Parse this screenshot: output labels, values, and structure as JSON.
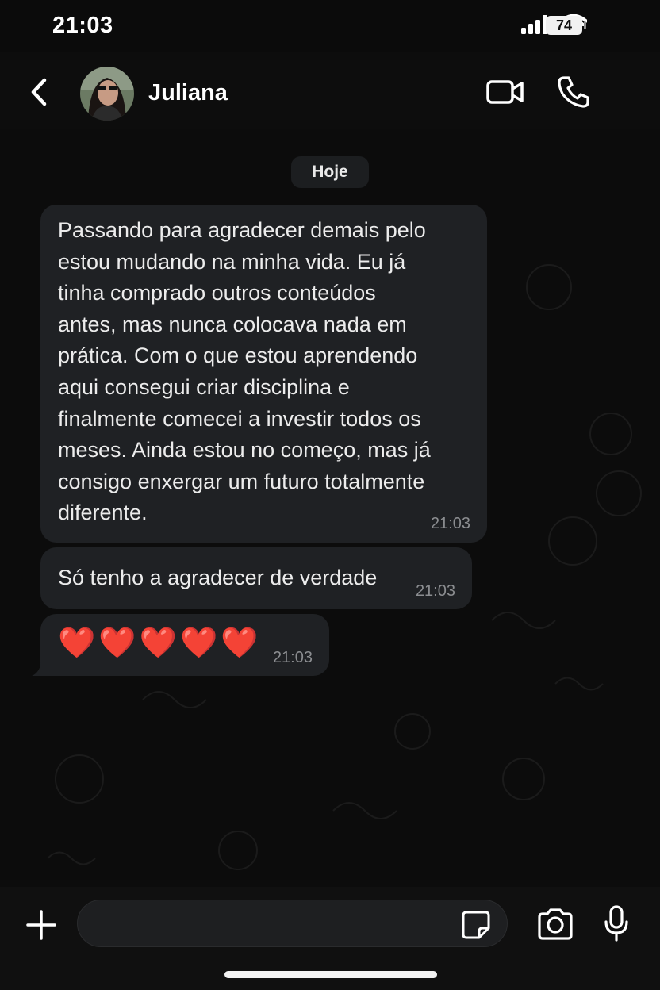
{
  "status_bar": {
    "time": "21:03",
    "battery": "74",
    "icons": [
      "signal-icon",
      "wifi-icon",
      "battery-icon"
    ]
  },
  "header": {
    "contact_name": "Juliana",
    "icons": {
      "back": "chevron-left-icon",
      "video": "video-camera-icon",
      "call": "phone-icon"
    }
  },
  "chat": {
    "date_label": "Hoje",
    "messages": [
      {
        "lines": [
          "Passando para agradecer demais pelo",
          "estou mudando na minha vida. Eu já",
          "tinha comprado outros conteúdos",
          "antes, mas nunca colocava nada em",
          "prática. Com o que estou aprendendo",
          "aqui consegui criar disciplina e",
          "finalmente comecei a investir todos os",
          "meses. Ainda estou no começo, mas já",
          "consigo enxergar um futuro totalmente",
          "diferente."
        ],
        "time": "21:03"
      },
      {
        "text": "Só tenho a agradecer de verdade",
        "time": "21:03"
      },
      {
        "text": "❤️❤️❤️❤️❤️",
        "time": "21:03"
      }
    ]
  },
  "input_bar": {
    "placeholder": "",
    "icons": {
      "plus": "plus-icon",
      "sticker": "sticker-icon",
      "camera": "camera-icon",
      "mic": "microphone-icon"
    }
  },
  "colors": {
    "background": "#0b0b0b",
    "bubble": "#1f2124",
    "heart": "#e11d2b",
    "timestamp": "#8b8d90"
  }
}
